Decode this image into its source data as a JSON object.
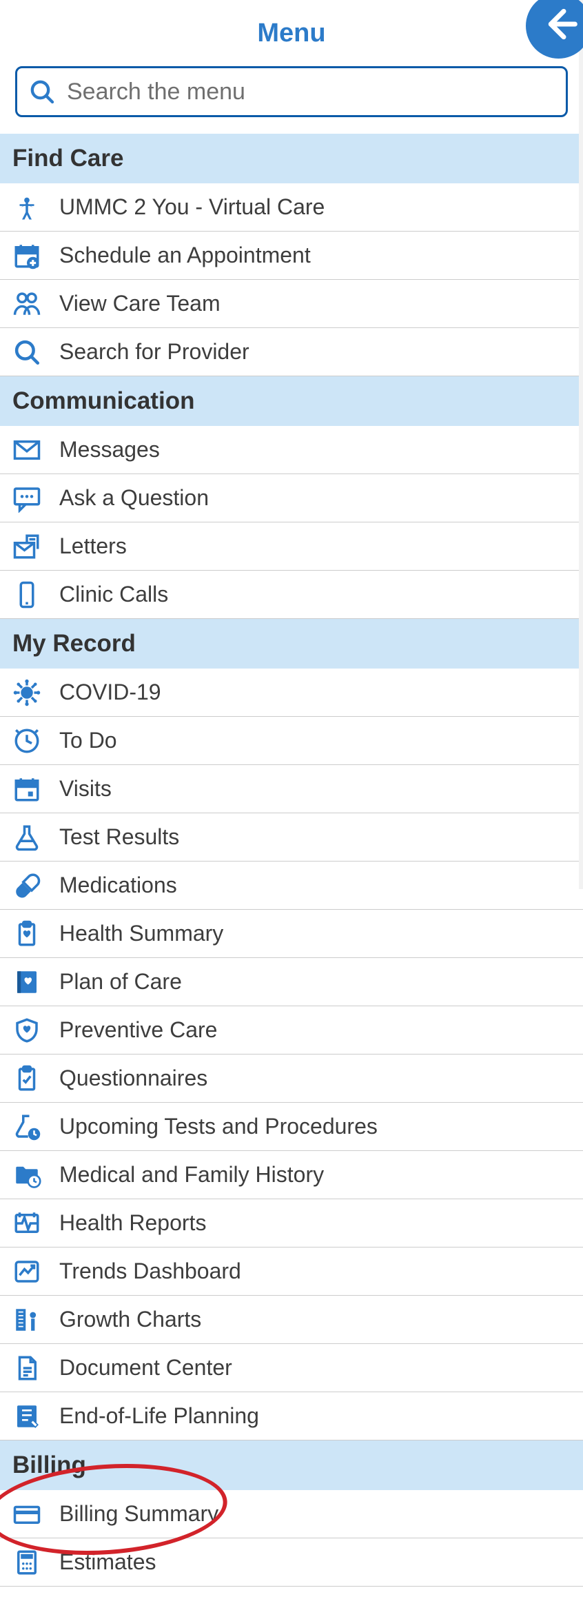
{
  "header": {
    "title": "Menu"
  },
  "search": {
    "placeholder": "Search the menu"
  },
  "sections": [
    {
      "title": "Find Care",
      "items": [
        {
          "icon": "person-star-icon",
          "label": "UMMC 2 You - Virtual Care"
        },
        {
          "icon": "calendar-plus-icon",
          "label": "Schedule an Appointment"
        },
        {
          "icon": "people-icon",
          "label": "View Care Team"
        },
        {
          "icon": "search-icon",
          "label": "Search for Provider"
        }
      ]
    },
    {
      "title": "Communication",
      "items": [
        {
          "icon": "envelope-icon",
          "label": "Messages"
        },
        {
          "icon": "chat-icon",
          "label": "Ask a Question"
        },
        {
          "icon": "letter-icon",
          "label": "Letters"
        },
        {
          "icon": "phone-icon",
          "label": "Clinic Calls"
        }
      ]
    },
    {
      "title": "My Record",
      "items": [
        {
          "icon": "virus-icon",
          "label": "COVID-19"
        },
        {
          "icon": "clock-check-icon",
          "label": "To Do"
        },
        {
          "icon": "calendar-dot-icon",
          "label": "Visits"
        },
        {
          "icon": "flask-icon",
          "label": "Test Results"
        },
        {
          "icon": "pill-icon",
          "label": "Medications"
        },
        {
          "icon": "clipboard-heart-icon",
          "label": "Health Summary"
        },
        {
          "icon": "book-heart-icon",
          "label": "Plan of Care"
        },
        {
          "icon": "shield-heart-icon",
          "label": "Preventive Care"
        },
        {
          "icon": "clipboard-check-icon",
          "label": "Questionnaires"
        },
        {
          "icon": "flask-clock-icon",
          "label": "Upcoming Tests and Procedures"
        },
        {
          "icon": "folder-clock-icon",
          "label": "Medical and Family History"
        },
        {
          "icon": "heartbeat-icon",
          "label": "Health Reports"
        },
        {
          "icon": "trend-icon",
          "label": "Trends Dashboard"
        },
        {
          "icon": "growth-chart-icon",
          "label": "Growth Charts"
        },
        {
          "icon": "document-icon",
          "label": "Document Center"
        },
        {
          "icon": "planning-icon",
          "label": "End-of-Life Planning"
        }
      ]
    },
    {
      "title": "Billing",
      "items": [
        {
          "icon": "credit-card-icon",
          "label": "Billing Summary"
        },
        {
          "icon": "calculator-icon",
          "label": "Estimates"
        }
      ]
    }
  ]
}
